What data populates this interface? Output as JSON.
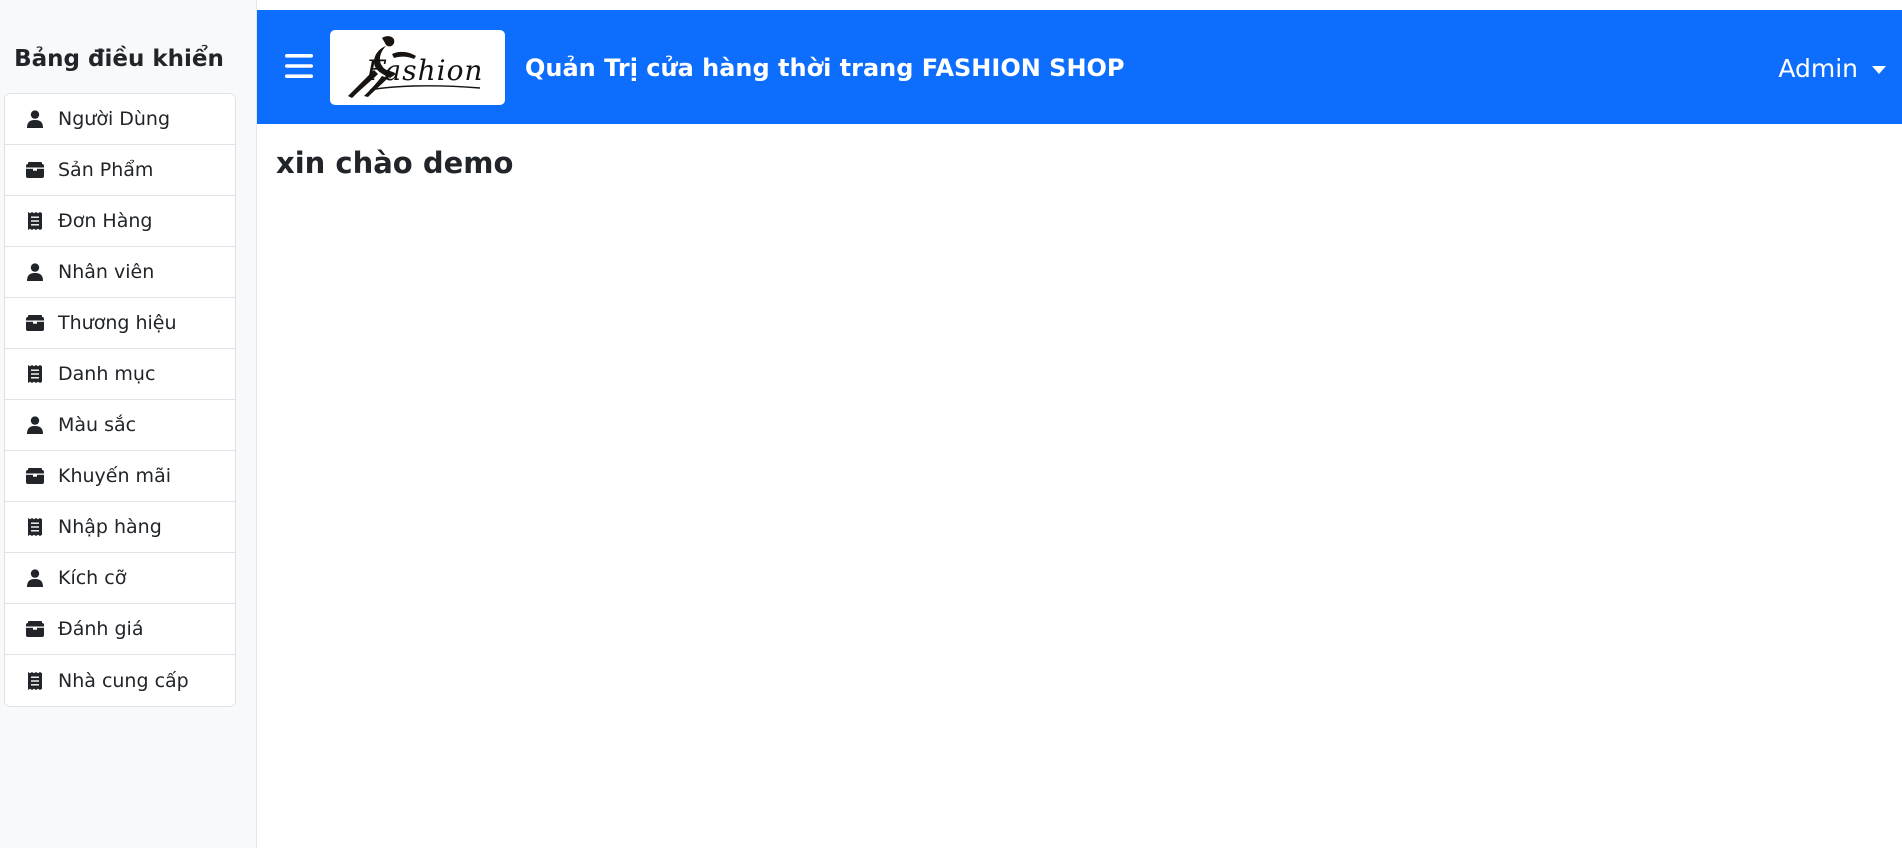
{
  "sidebar": {
    "title": "Bảng điều khiển",
    "items": [
      {
        "label": "Người Dùng",
        "icon": "user-icon"
      },
      {
        "label": "Sản Phẩm",
        "icon": "box-icon"
      },
      {
        "label": "Đơn Hàng",
        "icon": "receipt-icon"
      },
      {
        "label": "Nhân viên",
        "icon": "user-icon"
      },
      {
        "label": "Thương hiệu",
        "icon": "box-icon"
      },
      {
        "label": "Danh mục",
        "icon": "receipt-icon"
      },
      {
        "label": "Màu sắc",
        "icon": "user-icon"
      },
      {
        "label": "Khuyến mãi",
        "icon": "box-icon"
      },
      {
        "label": "Nhập hàng",
        "icon": "receipt-icon"
      },
      {
        "label": "Kích cỡ",
        "icon": "user-icon"
      },
      {
        "label": "Đánh giá",
        "icon": "box-icon"
      },
      {
        "label": "Nhà cung cấp",
        "icon": "receipt-icon"
      }
    ]
  },
  "header": {
    "logo_text": "Fashion",
    "title": "Quản Trị cửa hàng thời trang FASHION SHOP",
    "user_menu": "Admin"
  },
  "main": {
    "greeting": "xin chào demo"
  },
  "colors": {
    "primary": "#0d6efd",
    "sidebar_bg": "#f8f9fa",
    "text": "#212529"
  }
}
